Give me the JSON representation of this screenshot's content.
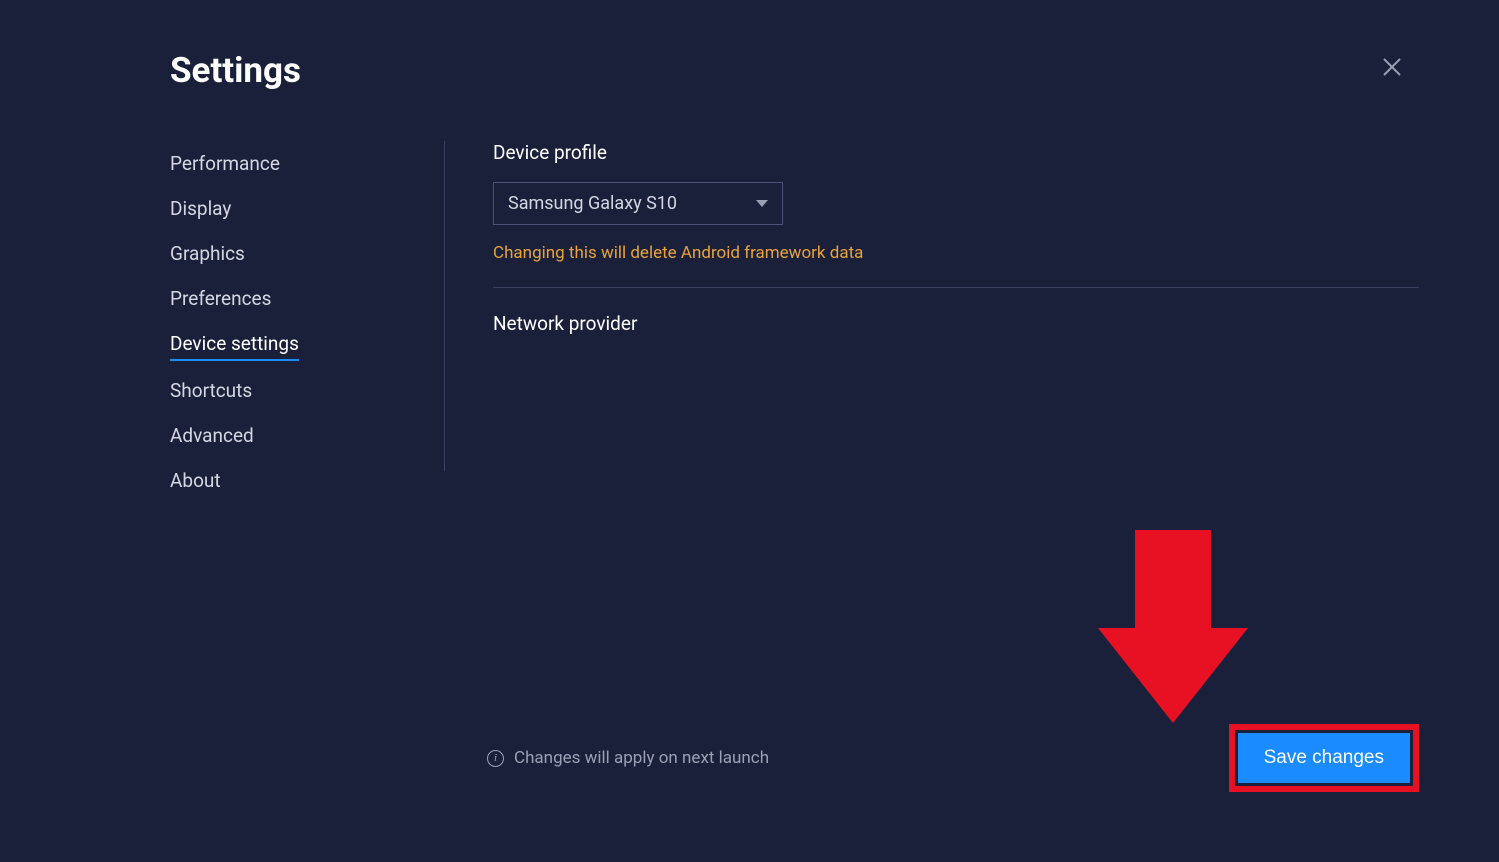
{
  "title": "Settings",
  "sidebar": {
    "items": [
      {
        "label": "Performance",
        "active": false
      },
      {
        "label": "Display",
        "active": false
      },
      {
        "label": "Graphics",
        "active": false
      },
      {
        "label": "Preferences",
        "active": false
      },
      {
        "label": "Device settings",
        "active": true
      },
      {
        "label": "Shortcuts",
        "active": false
      },
      {
        "label": "Advanced",
        "active": false
      },
      {
        "label": "About",
        "active": false
      }
    ]
  },
  "main": {
    "device_profile_label": "Device profile",
    "device_profile_value": "Samsung Galaxy S10",
    "device_profile_warning": "Changing this will delete Android framework data",
    "network_provider_label": "Network provider"
  },
  "footer": {
    "info_text": "Changes will apply on next launch",
    "save_label": "Save changes"
  }
}
